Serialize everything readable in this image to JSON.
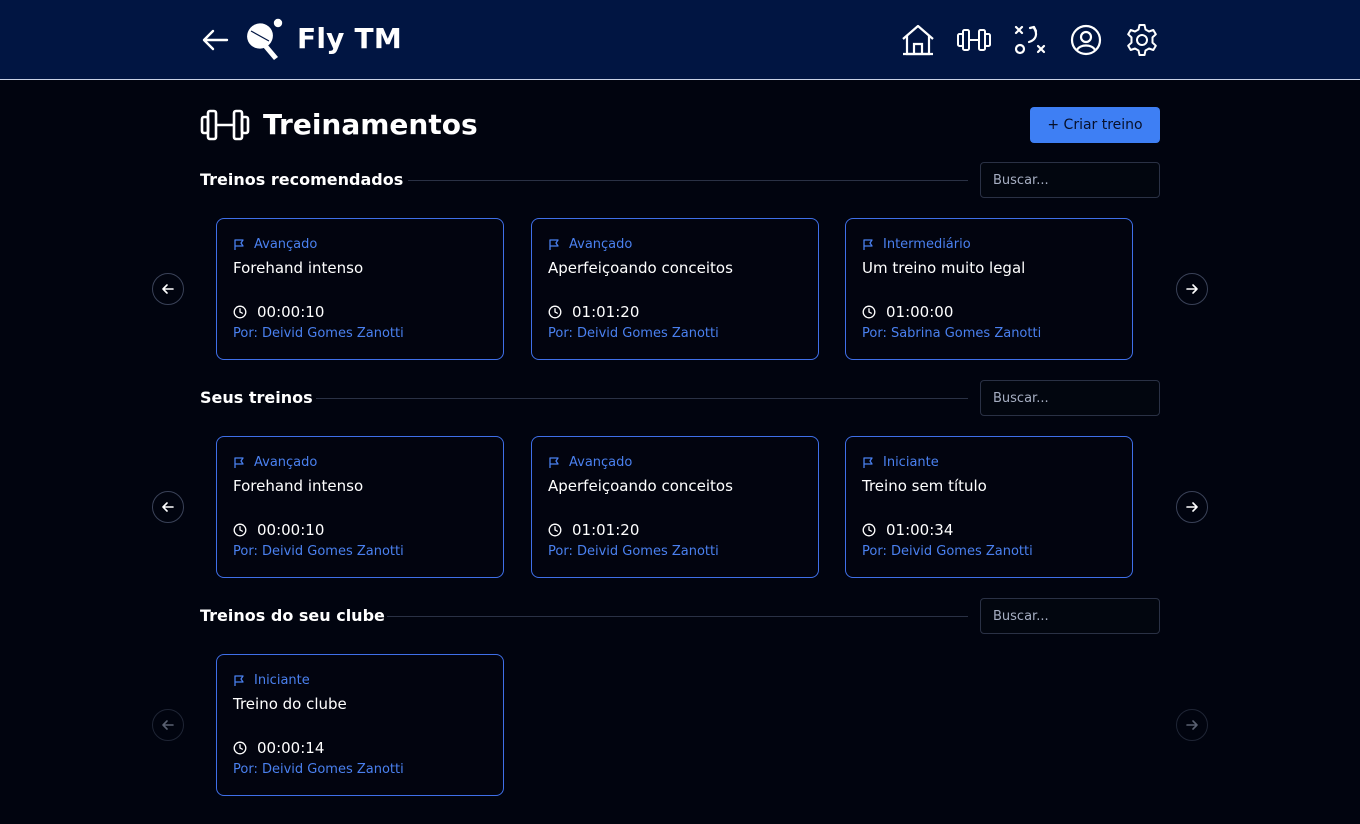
{
  "app": {
    "brand": "Fly TM"
  },
  "nav": {
    "items": [
      {
        "name": "home-icon"
      },
      {
        "name": "dumbbell-icon"
      },
      {
        "name": "tactics-icon"
      },
      {
        "name": "user-circle-icon"
      },
      {
        "name": "gear-icon"
      }
    ]
  },
  "page": {
    "title": "Treinamentos",
    "create_label": "+ Criar treino"
  },
  "colors": {
    "header_bg": "#011542",
    "page_bg": "#01040f",
    "accent": "#3e7ff4",
    "card_border": "#3f6fe8",
    "level_text": "#4a80ef"
  },
  "sections": [
    {
      "title": "Treinos recomendados",
      "search_placeholder": "Buscar...",
      "cards": [
        {
          "level": "Avançado",
          "title": "Forehand intenso",
          "time": "00:00:10",
          "author": "Por: Deivid Gomes Zanotti"
        },
        {
          "level": "Avançado",
          "title": "Aperfeiçoando conceitos",
          "time": "01:01:20",
          "author": "Por: Deivid Gomes Zanotti"
        },
        {
          "level": "Intermediário",
          "title": "Um treino muito legal",
          "time": "01:00:00",
          "author": "Por: Sabrina Gomes Zanotti"
        }
      ]
    },
    {
      "title": "Seus treinos",
      "search_placeholder": "Buscar...",
      "cards": [
        {
          "level": "Avançado",
          "title": "Forehand intenso",
          "time": "00:00:10",
          "author": "Por: Deivid Gomes Zanotti"
        },
        {
          "level": "Avançado",
          "title": "Aperfeiçoando conceitos",
          "time": "01:01:20",
          "author": "Por: Deivid Gomes Zanotti"
        },
        {
          "level": "Iniciante",
          "title": "Treino sem título",
          "time": "01:00:34",
          "author": "Por: Deivid Gomes Zanotti"
        }
      ]
    },
    {
      "title": "Treinos do seu clube",
      "search_placeholder": "Buscar...",
      "cards": [
        {
          "level": "Iniciante",
          "title": "Treino do clube",
          "time": "00:00:14",
          "author": "Por: Deivid Gomes Zanotti"
        }
      ]
    }
  ]
}
